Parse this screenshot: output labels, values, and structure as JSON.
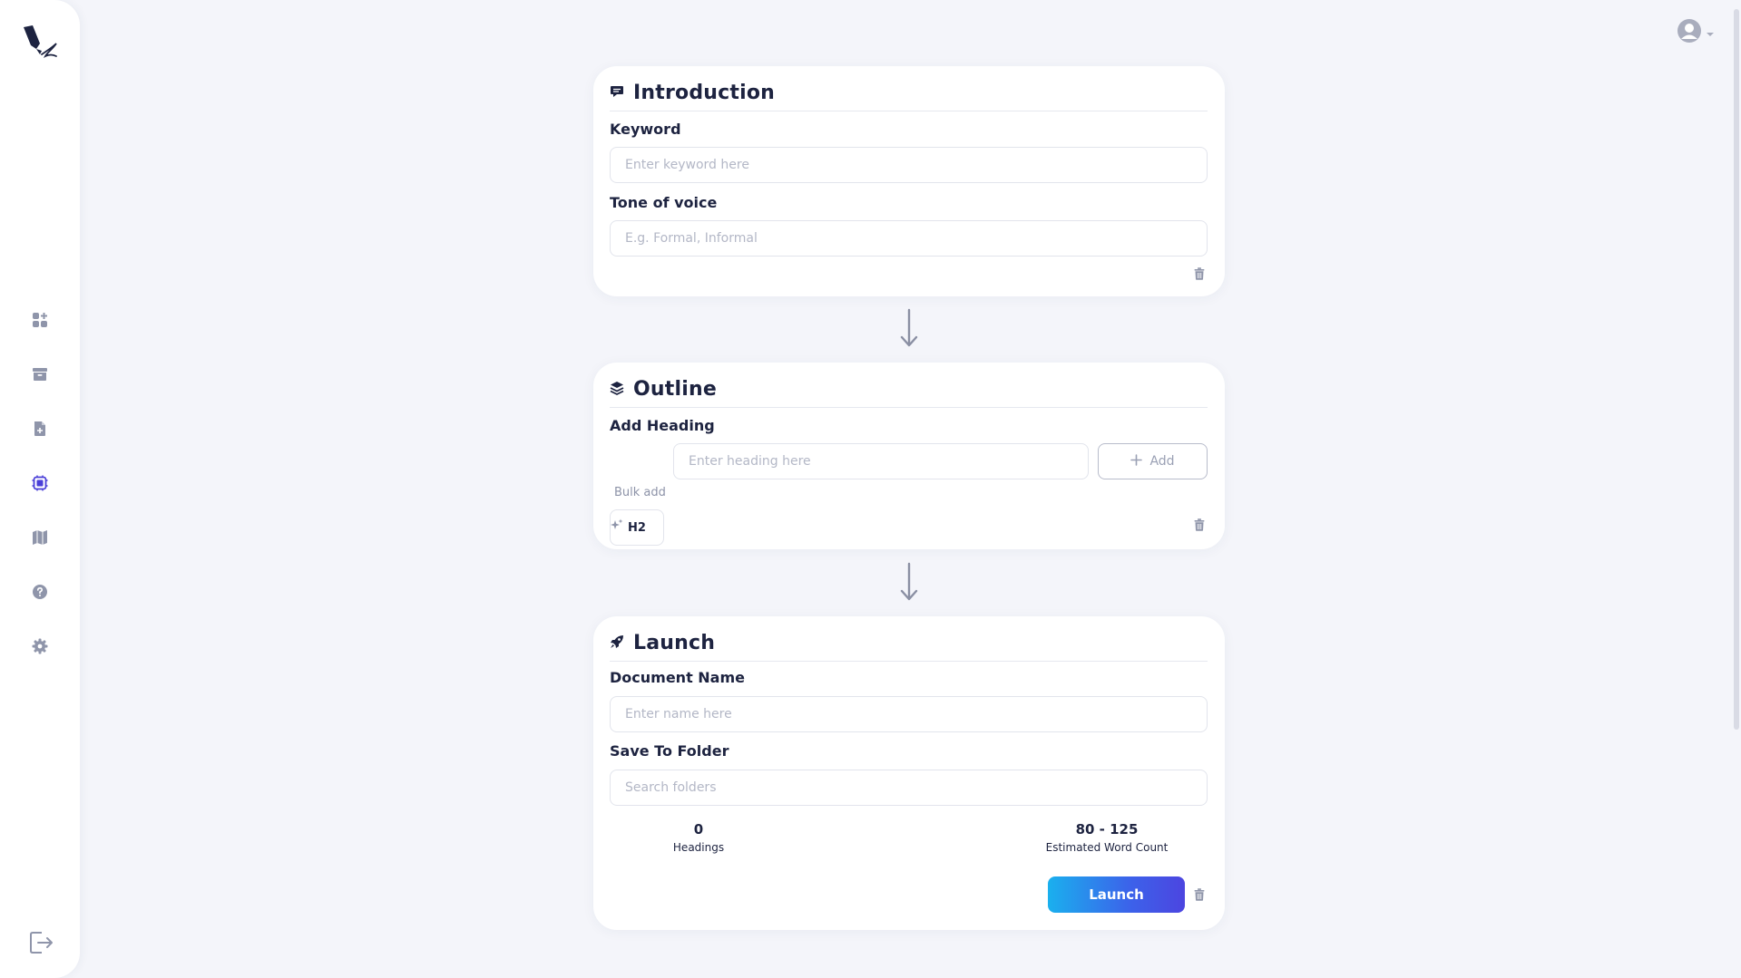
{
  "sidebar": {
    "nav_items": [
      {
        "name": "dashboard",
        "icon": "grid-plus-icon",
        "active": false
      },
      {
        "name": "archive",
        "icon": "archive-box-icon",
        "active": false
      },
      {
        "name": "new-document",
        "icon": "document-plus-icon",
        "active": false
      },
      {
        "name": "workflow",
        "icon": "chip-icon",
        "active": true
      },
      {
        "name": "map",
        "icon": "map-icon",
        "active": false
      },
      {
        "name": "help",
        "icon": "question-circle-icon",
        "active": false
      },
      {
        "name": "settings",
        "icon": "gear-icon",
        "active": false
      }
    ],
    "logout_icon": "logout-icon"
  },
  "header": {
    "avatar_icon": "user-circle-icon",
    "dropdown_icon": "caret-down-icon"
  },
  "introduction": {
    "title": "Introduction",
    "icon": "chat-bubble-icon",
    "keyword_label": "Keyword",
    "keyword_placeholder": "Enter keyword here",
    "tone_label": "Tone of voice",
    "tone_placeholder": "E.g. Formal, Informal"
  },
  "outline": {
    "title": "Outline",
    "icon": "layers-icon",
    "add_heading_label": "Add Heading",
    "heading_level": "H2",
    "heading_placeholder": "Enter heading here",
    "add_button_label": "Add",
    "bulk_add_label": "Bulk add"
  },
  "launch": {
    "title": "Launch",
    "icon": "rocket-icon",
    "document_name_label": "Document Name",
    "document_name_placeholder": "Enter name here",
    "folder_label": "Save To Folder",
    "folder_placeholder": "Search folders",
    "headings_count": "0",
    "headings_label": "Headings",
    "word_count": "80 - 125",
    "word_count_label": "Estimated Word Count",
    "launch_button_label": "Launch"
  },
  "colors": {
    "accent": "#4a3fd8",
    "icon_muted": "#8f95aa",
    "text_dark": "#1d2340",
    "launch_gradient_start": "#1ab0ee",
    "launch_gradient_end": "#4c45e0"
  }
}
